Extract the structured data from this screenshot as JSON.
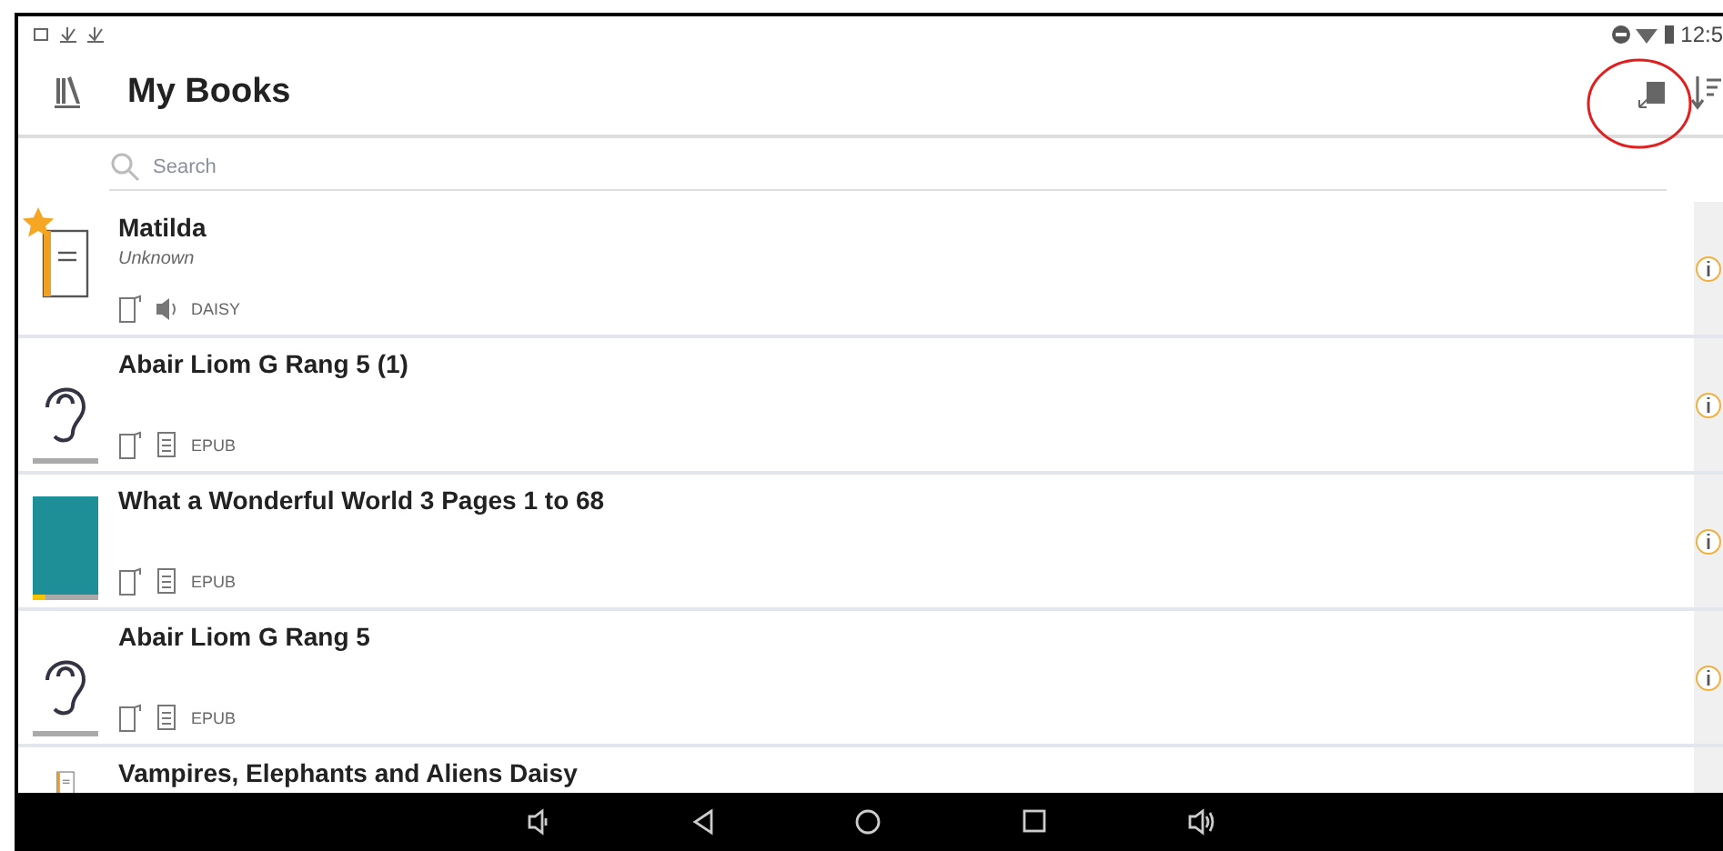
{
  "status_bar": {
    "time": "12:5"
  },
  "toolbar": {
    "title": "My Books"
  },
  "search": {
    "placeholder": "Search"
  },
  "books": [
    {
      "title": "Matilda",
      "author": "Unknown",
      "format": {
        "kind": "audio",
        "label": "DAISY"
      },
      "kind": "book",
      "starred": true
    },
    {
      "title": "Abair Liom G Rang 5 (1)",
      "format": {
        "kind": "text",
        "label": "EPUB"
      },
      "kind": "ear",
      "starred": false,
      "progress": {
        "level": 0
      }
    },
    {
      "title": "What a Wonderful World 3 Pages 1 to 68",
      "format": {
        "kind": "text",
        "label": "EPUB"
      },
      "kind": "photo",
      "starred": false,
      "progress": {
        "level": 0.2
      }
    },
    {
      "title": "Abair Liom G Rang 5",
      "format": {
        "kind": "text",
        "label": "EPUB"
      },
      "kind": "ear",
      "starred": false,
      "progress": {
        "level": 0
      }
    },
    {
      "title": "Vampires, Elephants and Aliens Daisy",
      "kind": "book",
      "starred": false,
      "partial": true
    }
  ]
}
